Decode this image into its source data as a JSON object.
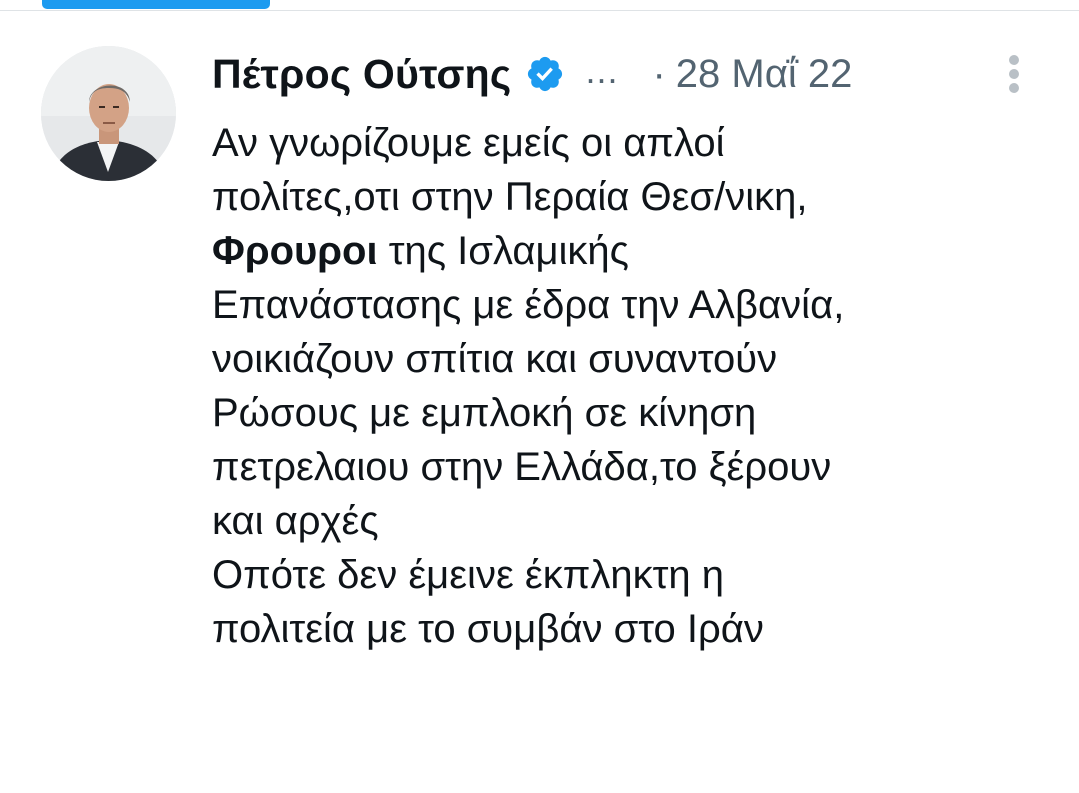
{
  "author": {
    "name": "Πέτρος Ούτσης",
    "verified": true,
    "verified_icon": "verified-badge-icon",
    "truncation": "...",
    "separator": "·",
    "date": "28 Μαΐ 22"
  },
  "tweet": {
    "lines": [
      "Αν γνωρίζουμε εμείς οι απλοί",
      "πολίτες,οτι στην Περαία Θεσ/νικη,",
      {
        "bold": "Φρουροι",
        "rest": " της Ισλαμικής"
      },
      "Επανάστασης με έδρα την Αλβανία,",
      "νοικιάζουν σπίτια και συναντούν",
      "Ρώσους με εμπλοκή σε κίνηση",
      "πετρελαιου στην Ελλάδα,το ξέρουν",
      "και αρχές",
      "Οπότε δεν έμεινε έκπληκτη η",
      "πολιτεία με το συμβάν στο Ιράν"
    ]
  },
  "colors": {
    "accent": "#1d9bf0",
    "text": "#0f1419",
    "secondary_text": "#536471",
    "more_dots": "#b9c0c6"
  },
  "icons": {
    "avatar": "profile-photo",
    "more": "more-options-vertical-icon"
  }
}
